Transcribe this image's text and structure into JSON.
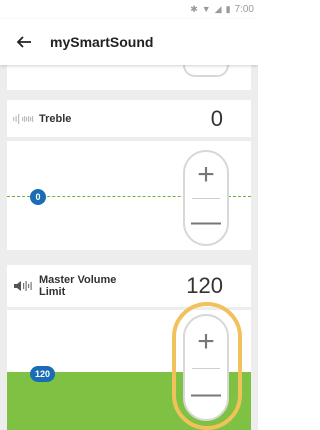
{
  "status_bar": {
    "time": "7:00",
    "icons": [
      "bluetooth-icon",
      "wifi-icon",
      "signal-icon",
      "battery-icon"
    ]
  },
  "app_bar": {
    "back_icon": "arrow-back-icon",
    "title": "mySmartSound"
  },
  "controls": {
    "treble": {
      "label": "Treble",
      "value": "0",
      "indicator": "0",
      "icon": "treble-wave-icon",
      "increase_symbol": "+",
      "decrease_symbol": "—"
    },
    "master_volume_limit": {
      "label_line1": "Master Volume",
      "label_line2": "Limit",
      "value": "120",
      "indicator": "120",
      "icon": "volume-limit-icon",
      "increase_symbol": "+",
      "decrease_symbol": "—"
    }
  },
  "colors": {
    "accent_blue": "#1a6db5",
    "level_green": "#7fc142",
    "highlight_orange": "#f1c25c",
    "background_gray": "#ededed"
  }
}
